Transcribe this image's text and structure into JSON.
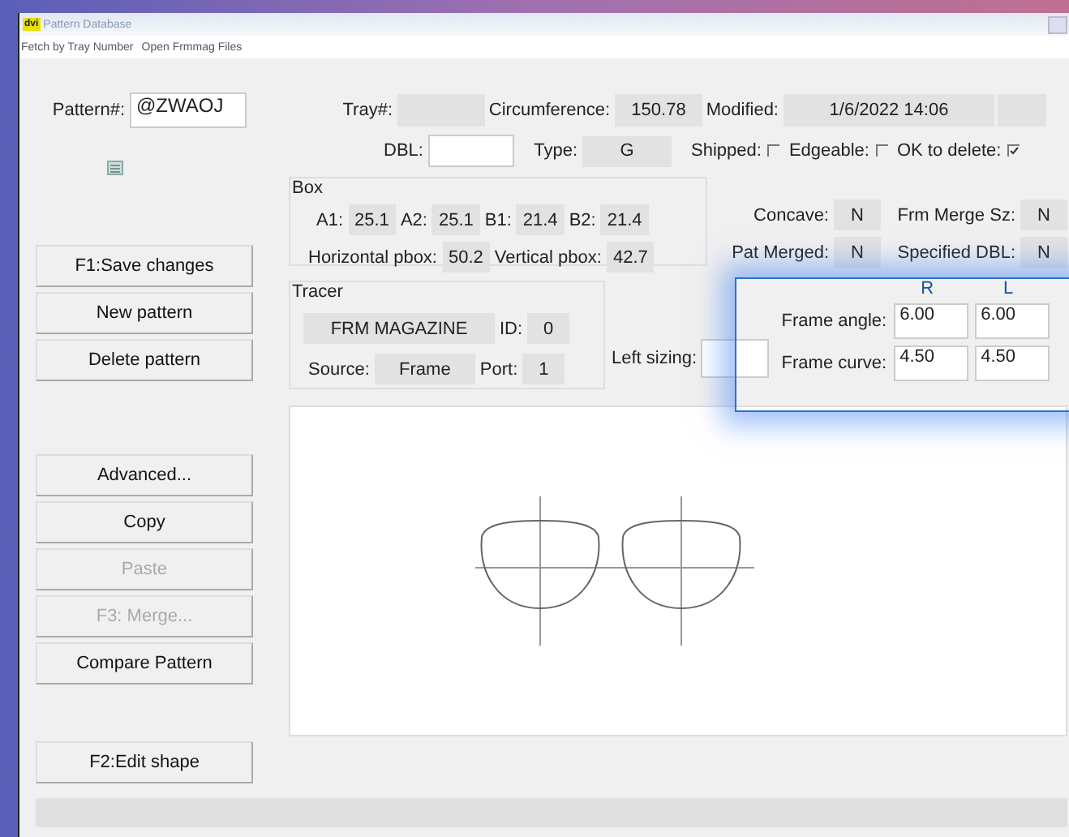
{
  "window": {
    "badge": "dvi",
    "title": "Pattern Database"
  },
  "menu": [
    {
      "label": "Fetch by Tray Number"
    },
    {
      "label": "Open Frmmag Files"
    }
  ],
  "pattern": {
    "label": "Pattern#:",
    "value": "@ZWAOJ"
  },
  "row1": [
    {
      "label": "Tray#:"
    },
    {
      "label": "Circumference:",
      "value": "150.78"
    },
    {
      "label": "Modified:",
      "value": "1/6/2022 14:06"
    }
  ],
  "row2": [
    {
      "label": "DBL:",
      "kind": "input"
    },
    {
      "label": "Type:",
      "value": "G",
      "kind": "readonly"
    }
  ],
  "checkboxes": [
    {
      "label": "Shipped:",
      "checked": false
    },
    {
      "label": "Edgeable:",
      "checked": false
    },
    {
      "label": "OK to delete:",
      "checked": true
    }
  ],
  "box": {
    "title": "Box",
    "lines": [
      {
        "fields": [
          {
            "label": "A1:",
            "value": "25.1"
          },
          {
            "label": "A2:",
            "value": "25.1"
          },
          {
            "label": "B1:",
            "value": "21.4"
          },
          {
            "label": "B2:",
            "value": "21.4"
          }
        ]
      },
      {
        "fields": [
          {
            "label": "Horizontal pbox:",
            "value": "50.2"
          },
          {
            "label": "Vertical pbox:",
            "value": "42.7"
          }
        ]
      }
    ]
  },
  "flags": [
    [
      {
        "label": "Concave:",
        "value": "N"
      },
      {
        "label": "Frm Merge Sz:",
        "value": "N"
      }
    ],
    [
      {
        "label": "Pat Merged:",
        "value": "N"
      },
      {
        "label": "Specified DBL:",
        "value": "N"
      }
    ]
  ],
  "tracer": {
    "title": "Tracer",
    "lines": [
      {
        "fields": [
          {
            "value": "FRM MAGAZINE"
          },
          {
            "label": "ID:",
            "value": "0"
          }
        ]
      },
      {
        "fields": [
          {
            "label": "Source:",
            "value": "Frame"
          },
          {
            "label": "Port:",
            "value": "1"
          }
        ]
      }
    ]
  },
  "left_sizing": {
    "label": "Left sizing:"
  },
  "frame": {
    "columns": [
      "R",
      "L"
    ],
    "rows": [
      {
        "label": "Frame angle:",
        "r": "6.00",
        "l": "6.00"
      },
      {
        "label": "Frame curve:",
        "r": "4.50",
        "l": "4.50"
      }
    ]
  },
  "buttons_top": [
    {
      "label": "F1:Save changes",
      "disabled": false
    },
    {
      "label": "New pattern",
      "disabled": false
    },
    {
      "label": "Delete pattern",
      "disabled": false
    }
  ],
  "buttons_middle": [
    {
      "label": "Advanced...",
      "disabled": false
    },
    {
      "label": "Copy",
      "disabled": false
    },
    {
      "label": "Paste",
      "disabled": true
    },
    {
      "label": "F3: Merge...",
      "disabled": true
    },
    {
      "label": "Compare Pattern",
      "disabled": false
    }
  ],
  "buttons_bottom": [
    {
      "label": "F2:Edit shape",
      "disabled": false
    }
  ]
}
